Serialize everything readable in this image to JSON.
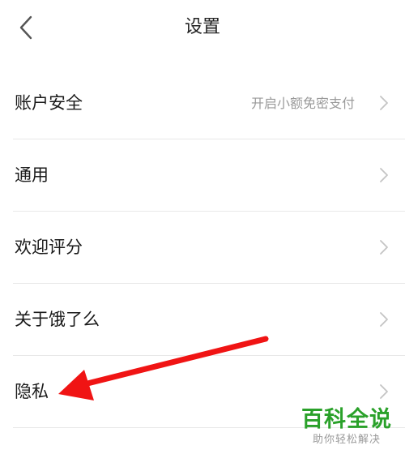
{
  "header": {
    "title": "设置"
  },
  "settings": {
    "items": [
      {
        "label": "账户安全",
        "value": "开启小额免密支付"
      },
      {
        "label": "通用",
        "value": ""
      },
      {
        "label": "欢迎评分",
        "value": ""
      },
      {
        "label": "关于饿了么",
        "value": ""
      },
      {
        "label": "隐私",
        "value": ""
      }
    ]
  },
  "annotation": {
    "arrow_color": "#f01414"
  },
  "watermark": {
    "main": "百科全说",
    "sub": "助你轻松解决",
    "color": "#2aa12a"
  },
  "icons": {
    "back": "chevron-left-icon",
    "row_arrow": "chevron-right-icon"
  }
}
